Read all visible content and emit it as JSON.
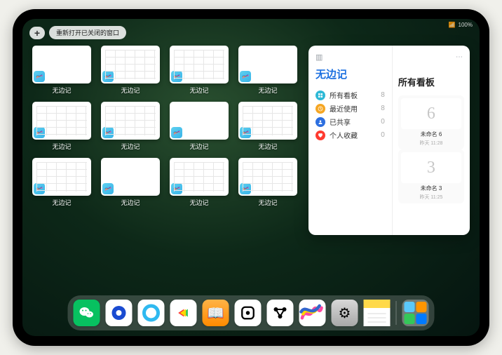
{
  "status": {
    "signal": "📶",
    "battery": "100%"
  },
  "top": {
    "plus": "+",
    "reopen_label": "重新打开已关闭的窗口"
  },
  "windows": [
    {
      "label": "无边记",
      "variant": "blank"
    },
    {
      "label": "无边记",
      "variant": "grid"
    },
    {
      "label": "无边记",
      "variant": "grid"
    },
    {
      "label": "无边记",
      "variant": "blank"
    },
    {
      "label": "无边记",
      "variant": "grid"
    },
    {
      "label": "无边记",
      "variant": "grid"
    },
    {
      "label": "无边记",
      "variant": "blank"
    },
    {
      "label": "无边记",
      "variant": "grid"
    },
    {
      "label": "无边记",
      "variant": "grid"
    },
    {
      "label": "无边记",
      "variant": "blank"
    },
    {
      "label": "无边记",
      "variant": "grid"
    },
    {
      "label": "无边记",
      "variant": "grid"
    }
  ],
  "popup": {
    "app_name": "无边记",
    "right_title": "所有看板",
    "filters": [
      {
        "label": "所有看板",
        "count": "8",
        "color": "#2fb9d6",
        "icon": "grid"
      },
      {
        "label": "最近使用",
        "count": "8",
        "color": "#f5a623",
        "icon": "clock"
      },
      {
        "label": "已共享",
        "count": "0",
        "color": "#2d6fe0",
        "icon": "person"
      },
      {
        "label": "个人收藏",
        "count": "0",
        "color": "#ff3b30",
        "icon": "heart"
      }
    ],
    "boards": [
      {
        "glyph": "6",
        "name": "未命名 6",
        "date": "昨天 11:28"
      },
      {
        "glyph": "3",
        "name": "未命名 3",
        "date": "昨天 11:25"
      }
    ]
  },
  "dock": {
    "items": [
      {
        "name": "wechat",
        "bg": "#07c160",
        "glyph_svg": "wechat"
      },
      {
        "name": "tencent-video",
        "bg": "#ffffff",
        "glyph_svg": "blue-ring"
      },
      {
        "name": "qq-browser",
        "bg": "#ffffff",
        "glyph_svg": "cyan-ring"
      },
      {
        "name": "play",
        "bg": "#ffffff",
        "glyph_svg": "play"
      },
      {
        "name": "books",
        "bg": "linear-gradient(#ffb347,#ff8a00)",
        "glyph": "📖"
      },
      {
        "name": "dice",
        "bg": "#ffffff",
        "glyph_svg": "dot-square"
      },
      {
        "name": "connect",
        "bg": "#ffffff",
        "glyph_svg": "barbell"
      },
      {
        "name": "freeform",
        "bg": "#ffffff",
        "glyph_svg": "scribble"
      },
      {
        "name": "settings",
        "bg": "linear-gradient(#d8d8d8,#a8a8a8)",
        "glyph": "⚙︎"
      },
      {
        "name": "notes",
        "bg": "#ffffff",
        "glyph_svg": "notes"
      }
    ],
    "recents": [
      {
        "c1": "#5ac8fa",
        "c2": "#ff9500",
        "c3": "#34c759",
        "c4": "#007aff"
      }
    ]
  }
}
